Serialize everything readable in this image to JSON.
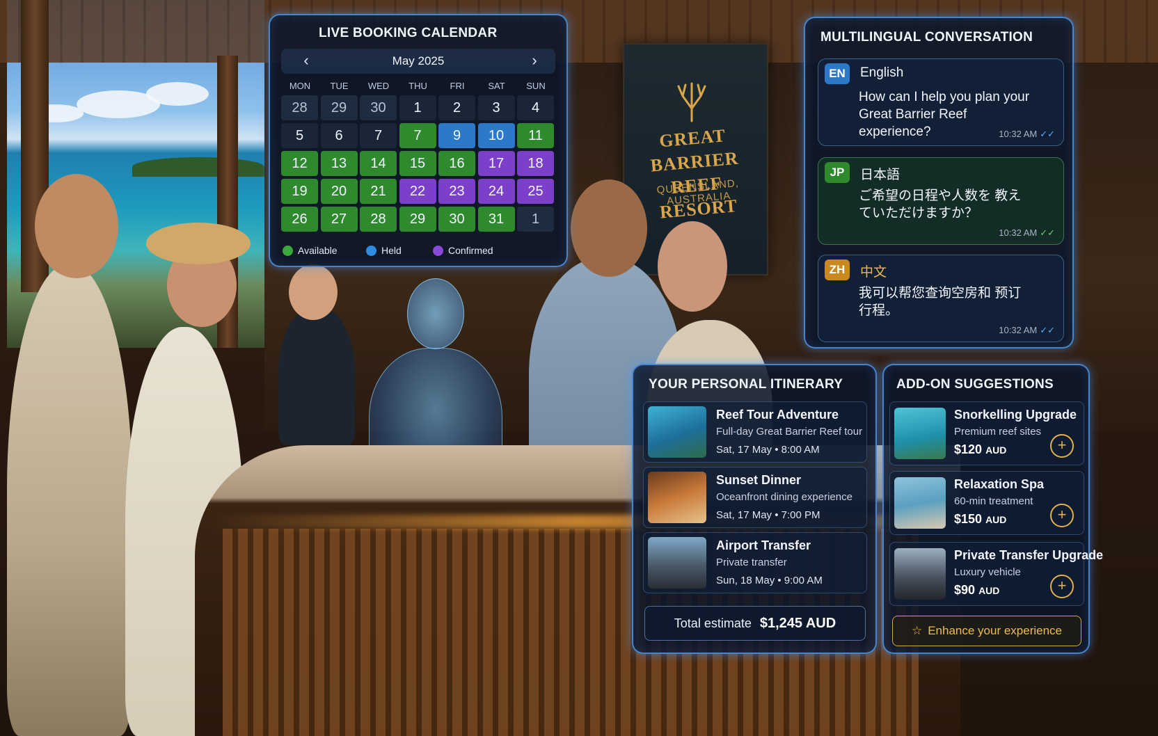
{
  "colors": {
    "panel_border": "#5aaaff",
    "available": "#2f8a2e",
    "held": "#2c78c9",
    "confirmed": "#7b3fc9",
    "accent_gold": "#e2b24a"
  },
  "sign": {
    "line1": "GREAT BARRIER",
    "line2": "REEF RESORT",
    "line3": "QUEENSLAND, AUSTRALIA"
  },
  "calendar": {
    "title": "LIVE BOOKING CALENDAR",
    "month_label": "May 2025",
    "prev_icon": "chevron-left-icon",
    "next_icon": "chevron-right-icon",
    "weekdays": [
      "MON",
      "TUE",
      "WED",
      "THU",
      "FRI",
      "SAT",
      "SUN"
    ],
    "weeks": [
      [
        {
          "d": "28",
          "s": "out"
        },
        {
          "d": "29",
          "s": "out"
        },
        {
          "d": "30",
          "s": "out"
        },
        {
          "d": "1",
          "s": "plain"
        },
        {
          "d": "2",
          "s": "plain"
        },
        {
          "d": "3",
          "s": "plain"
        },
        {
          "d": "4",
          "s": "plain"
        }
      ],
      [
        {
          "d": "5",
          "s": "plain"
        },
        {
          "d": "6",
          "s": "plain"
        },
        {
          "d": "7",
          "s": "plain"
        },
        {
          "d": "7",
          "s": "available"
        },
        {
          "d": "9",
          "s": "held"
        },
        {
          "d": "10",
          "s": "held"
        },
        {
          "d": "11",
          "s": "available"
        }
      ],
      [
        {
          "d": "12",
          "s": "available"
        },
        {
          "d": "13",
          "s": "available"
        },
        {
          "d": "14",
          "s": "available"
        },
        {
          "d": "15",
          "s": "available"
        },
        {
          "d": "16",
          "s": "available"
        },
        {
          "d": "17",
          "s": "confirmed"
        },
        {
          "d": "18",
          "s": "confirmed"
        }
      ],
      [
        {
          "d": "19",
          "s": "available"
        },
        {
          "d": "20",
          "s": "available"
        },
        {
          "d": "21",
          "s": "available"
        },
        {
          "d": "22",
          "s": "confirmed"
        },
        {
          "d": "23",
          "s": "confirmed"
        },
        {
          "d": "24",
          "s": "confirmed"
        },
        {
          "d": "25",
          "s": "confirmed"
        }
      ],
      [
        {
          "d": "26",
          "s": "available"
        },
        {
          "d": "27",
          "s": "available"
        },
        {
          "d": "28",
          "s": "available"
        },
        {
          "d": "29",
          "s": "available"
        },
        {
          "d": "30",
          "s": "available"
        },
        {
          "d": "31",
          "s": "available"
        },
        {
          "d": "1",
          "s": "out"
        }
      ]
    ],
    "legend": {
      "available": "Available",
      "held": "Held",
      "confirmed": "Confirmed"
    }
  },
  "conversation": {
    "title": "MULTILINGUAL CONVERSATION",
    "messages": [
      {
        "code": "EN",
        "language": "English",
        "text": "How can I help you plan your Great Barrier Reef experience?",
        "time": "10:32 AM",
        "badge_color": "#2c78c9"
      },
      {
        "code": "JP",
        "language": "日本語",
        "text": "ご希望の日程や人数を 教えていただけますか？",
        "time": "10:32 AM",
        "badge_color": "#2f8a2e"
      },
      {
        "code": "ZH",
        "language": "中文",
        "text": "我可以帮您查询空房和 预订行程。",
        "time": "10:32 AM",
        "badge_color": "#c9891f"
      }
    ],
    "read_icon": "double-check-icon"
  },
  "itinerary": {
    "title": "YOUR PERSONAL ITINERARY",
    "items": [
      {
        "title": "Reef Tour Adventure",
        "subtitle": "Full-day Great Barrier Reef tour",
        "when": "Sat, 17 May  •  8:00 AM",
        "thumb_icon": "reef-photo-icon"
      },
      {
        "title": "Sunset Dinner",
        "subtitle": "Oceanfront dining experience",
        "when": "Sat, 17 May  •  7:00 PM",
        "thumb_icon": "dining-photo-icon"
      },
      {
        "title": "Airport Transfer",
        "subtitle": "Private transfer",
        "when": "Sun, 18 May  •  9:00 AM",
        "thumb_icon": "car-photo-icon"
      }
    ],
    "total_label": "Total estimate",
    "total_value": "$1,245 AUD"
  },
  "addons": {
    "title": "ADD-ON SUGGESTIONS",
    "items": [
      {
        "title": "Snorkelling Upgrade",
        "subtitle": "Premium reef sites",
        "price": "$120",
        "currency": "AUD",
        "thumb_icon": "snorkel-photo-icon"
      },
      {
        "title": "Relaxation Spa",
        "subtitle": "60-min treatment",
        "price": "$150",
        "currency": "AUD",
        "thumb_icon": "spa-photo-icon"
      },
      {
        "title": "Private Transfer Upgrade",
        "subtitle": "Luxury vehicle",
        "price": "$90",
        "currency": "AUD",
        "thumb_icon": "suv-photo-icon"
      }
    ],
    "add_icon": "plus-circle-icon",
    "enhance_label": "Enhance your experience",
    "enhance_icon": "star-icon"
  }
}
